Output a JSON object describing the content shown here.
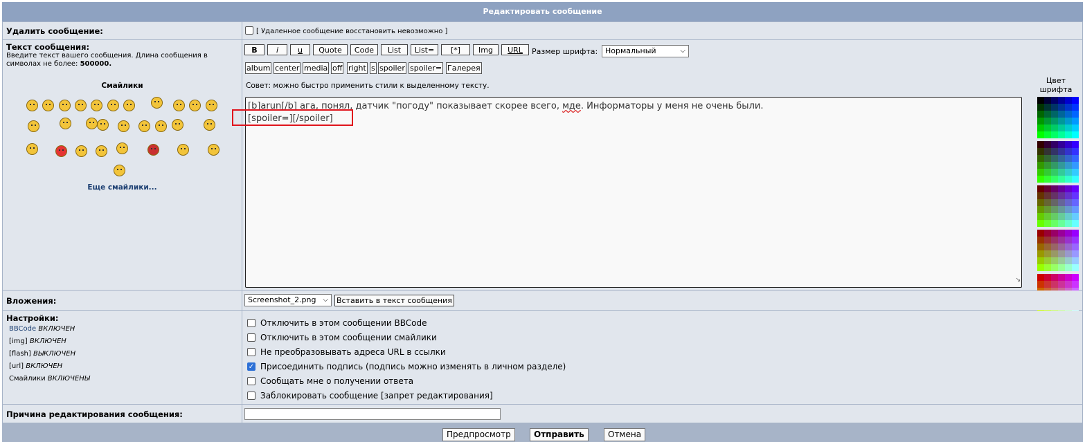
{
  "title": "Редактировать сообщение",
  "delete": {
    "label": "Удалить сообщение:",
    "note": "[ Удаленное сообщение восстановить невозможно ]"
  },
  "message": {
    "label": "Текст сообщения:",
    "hint": "Введите текст вашего сообщения. Длина сообщения в символах не более:",
    "max_len": "500000.",
    "smilies_title": "Смайлики",
    "more_smilies": "Еще смайлики...",
    "tip": "Совет: можно быстро применить стили к выделенному тексту.",
    "line1_a": "[b]arun[/b] ага, понял, датчик \"погоду\" показывает скорее всего, ",
    "line1_b": "мде",
    "line1_c": ". Информаторы у меня не очень были.",
    "line2": "[spoiler=][/spoiler]"
  },
  "toolbar": {
    "b": "B",
    "i": "i",
    "u": "u",
    "quote": "Quote",
    "code": "Code",
    "list": "List",
    "list_eq": "List=",
    "star": "[*]",
    "img": "Img",
    "url": "URL",
    "font_size_label": "Размер шрифта:",
    "font_size_value": "Нормальный",
    "album": "album",
    "center": "center",
    "media": "media",
    "off": "off",
    "right": "right",
    "s": "s",
    "spoiler": "spoiler",
    "spoiler_eq": "spoiler=",
    "gallery": "Галерея"
  },
  "color_label": "Цвет шрифта",
  "attach": {
    "label": "Вложения:",
    "file": "Screenshot_2.png",
    "insert": "Вставить в текст сообщения"
  },
  "settings": {
    "label": "Настройки:",
    "bbcode_link": "BBCode",
    "bbcode_state": "ВКЛЮЧЕН",
    "img_tag": "[img]",
    "img_state": "ВКЛЮЧЕН",
    "flash_tag": "[flash]",
    "flash_state": "ВЫКЛЮЧЕН",
    "url_tag": "[url]",
    "url_state": "ВКЛЮЧЕН",
    "smilies_tag": "Смайлики",
    "smilies_state": "ВКЛЮЧЕНЫ",
    "opt1": "Отключить в этом сообщении BBCode",
    "opt2": "Отключить в этом сообщении смайлики",
    "opt3": "Не преобразовывать адреса URL в ссылки",
    "opt4": "Присоединить подпись (подпись можно изменять в личном разделе)",
    "opt5": "Сообщать мне о получении ответа",
    "opt6": "Заблокировать сообщение [запрет редактирования]"
  },
  "reason": {
    "label": "Причина редактирования сообщения:",
    "value": ""
  },
  "actions": {
    "preview": "Предпросмотр",
    "submit": "Отправить",
    "cancel": "Отмена"
  },
  "palette": [
    [
      "#000000",
      "#000033",
      "#000066",
      "#000099",
      "#0000cc",
      "#0000ff"
    ],
    [
      "#003300",
      "#003333",
      "#003366",
      "#003399",
      "#0033cc",
      "#0033ff"
    ],
    [
      "#006600",
      "#006633",
      "#006666",
      "#006699",
      "#0066cc",
      "#0066ff"
    ],
    [
      "#009900",
      "#009933",
      "#009966",
      "#009999",
      "#0099cc",
      "#0099ff"
    ],
    [
      "#00cc00",
      "#00cc33",
      "#00cc66",
      "#00cc99",
      "#00cccc",
      "#00ccff"
    ],
    [
      "#00ff00",
      "#00ff33",
      "#00ff66",
      "#00ff99",
      "#00ffcc",
      "#00ffff"
    ],
    [
      "#330000",
      "#330033",
      "#330066",
      "#330099",
      "#3300cc",
      "#3300ff"
    ],
    [
      "#333300",
      "#333333",
      "#333366",
      "#333399",
      "#3333cc",
      "#3333ff"
    ],
    [
      "#336600",
      "#336633",
      "#336666",
      "#336699",
      "#3366cc",
      "#3366ff"
    ],
    [
      "#339900",
      "#339933",
      "#339966",
      "#339999",
      "#3399cc",
      "#3399ff"
    ],
    [
      "#33cc00",
      "#33cc33",
      "#33cc66",
      "#33cc99",
      "#33cccc",
      "#33ccff"
    ],
    [
      "#33ff00",
      "#33ff33",
      "#33ff66",
      "#33ff99",
      "#33ffcc",
      "#33ffff"
    ],
    [
      "#660000",
      "#660033",
      "#660066",
      "#660099",
      "#6600cc",
      "#6600ff"
    ],
    [
      "#663300",
      "#663333",
      "#663366",
      "#663399",
      "#6633cc",
      "#6633ff"
    ],
    [
      "#666600",
      "#666633",
      "#666666",
      "#666699",
      "#6666cc",
      "#6666ff"
    ],
    [
      "#669900",
      "#669933",
      "#669966",
      "#669999",
      "#6699cc",
      "#6699ff"
    ],
    [
      "#66cc00",
      "#66cc33",
      "#66cc66",
      "#66cc99",
      "#66cccc",
      "#66ccff"
    ],
    [
      "#66ff00",
      "#66ff33",
      "#66ff66",
      "#66ff99",
      "#66ffcc",
      "#66ffff"
    ],
    [
      "#990000",
      "#990033",
      "#990066",
      "#990099",
      "#9900cc",
      "#9900ff"
    ],
    [
      "#993300",
      "#993333",
      "#993366",
      "#993399",
      "#9933cc",
      "#9933ff"
    ],
    [
      "#996600",
      "#996633",
      "#996666",
      "#996699",
      "#9966cc",
      "#9966ff"
    ],
    [
      "#999900",
      "#999933",
      "#999966",
      "#999999",
      "#9999cc",
      "#9999ff"
    ],
    [
      "#99cc00",
      "#99cc33",
      "#99cc66",
      "#99cc99",
      "#99cccc",
      "#99ccff"
    ],
    [
      "#99ff00",
      "#99ff33",
      "#99ff66",
      "#99ff99",
      "#99ffcc",
      "#99ffff"
    ],
    [
      "#cc0000",
      "#cc0033",
      "#cc0066",
      "#cc0099",
      "#cc00cc",
      "#cc00ff"
    ],
    [
      "#cc3300",
      "#cc3333",
      "#cc3366",
      "#cc3399",
      "#cc33cc",
      "#cc33ff"
    ],
    [
      "#cc6600",
      "#cc6633",
      "#cc6666",
      "#cc6699",
      "#cc66cc",
      "#cc66ff"
    ],
    [
      "#cc9900",
      "#cc9933",
      "#cc9966",
      "#cc9999",
      "#cc99cc",
      "#cc99ff"
    ],
    [
      "#cccc00",
      "#cccc33",
      "#cccc66",
      "#cccc99",
      "#cccccc",
      "#ccccff"
    ],
    [
      "#ccff00",
      "#ccff33",
      "#ccff66",
      "#ccff99",
      "#ccffcc",
      "#ccffff"
    ],
    [
      "#ff0000",
      "#ff0033",
      "#ff0066",
      "#ff0099",
      "#ff00cc",
      "#ff00ff"
    ],
    [
      "#ff3300",
      "#ff3333",
      "#ff3366",
      "#ff3399",
      "#ff33cc",
      "#ff33ff"
    ],
    [
      "#ff6600",
      "#ff6633",
      "#ff6666",
      "#ff6699",
      "#ff66cc",
      "#ff66ff"
    ],
    [
      "#ff9900",
      "#ff9933",
      "#ff9966",
      "#ff9999",
      "#ff99cc",
      "#ff99ff"
    ],
    [
      "#ffcc00",
      "#ffcc33",
      "#ffcc66",
      "#ffcc99",
      "#ffcccc",
      "#ffccff"
    ],
    [
      "#ffff00",
      "#ffff33",
      "#ffff66",
      "#ffff99",
      "#ffffcc",
      "#ffffff"
    ]
  ]
}
